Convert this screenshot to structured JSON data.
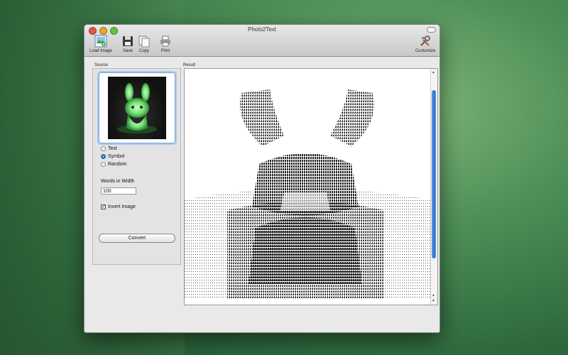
{
  "window": {
    "title": "Photo2Text"
  },
  "toolbar": {
    "load_image": "Load Image",
    "save": "Save",
    "copy": "Copy",
    "print": "Print",
    "customize": "Customize"
  },
  "source": {
    "label": "Source",
    "options": [
      "Text",
      "Symbol",
      "Random"
    ],
    "selected": "Symbol",
    "words_label": "Words in Width",
    "words_value": "100",
    "invert_label": "Invert Image",
    "invert_checked": true,
    "convert_label": "Convert"
  },
  "result": {
    "label": "Result"
  },
  "icons": [
    "load-image-icon",
    "save-icon",
    "copy-icon",
    "print-icon",
    "customize-icon"
  ]
}
